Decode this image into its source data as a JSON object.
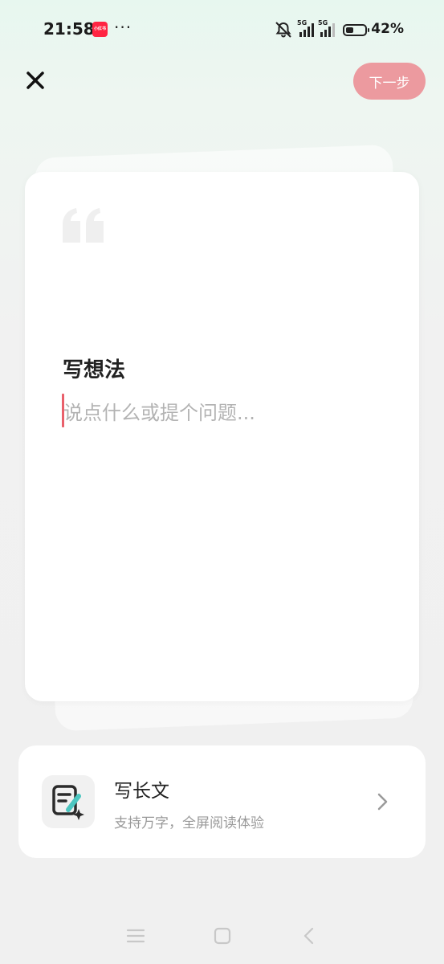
{
  "status_bar": {
    "time": "21:58",
    "app_badge": "小红书",
    "overflow": "···",
    "signal1_label": "5G",
    "signal2_label": "5G",
    "battery_level": 0.42,
    "battery_percent": "42%"
  },
  "header": {
    "close_icon": "close-icon",
    "next_label": "下一步"
  },
  "card": {
    "quote_icon": "quote-icon",
    "title": "写想法",
    "placeholder": "说点什么或提个问题..."
  },
  "longform": {
    "icon": "edit-doc-sparkle-icon",
    "title": "写长文",
    "subtitle": "支持万字，全屏阅读体验",
    "chevron": "chevron-right-icon"
  },
  "colors": {
    "accent": "#ec9a9f",
    "caret": "#e9606b",
    "pen_teal": "#4cc6c0"
  },
  "nav_bar": {
    "items": [
      "menu-icon",
      "home-icon",
      "back-icon"
    ]
  }
}
